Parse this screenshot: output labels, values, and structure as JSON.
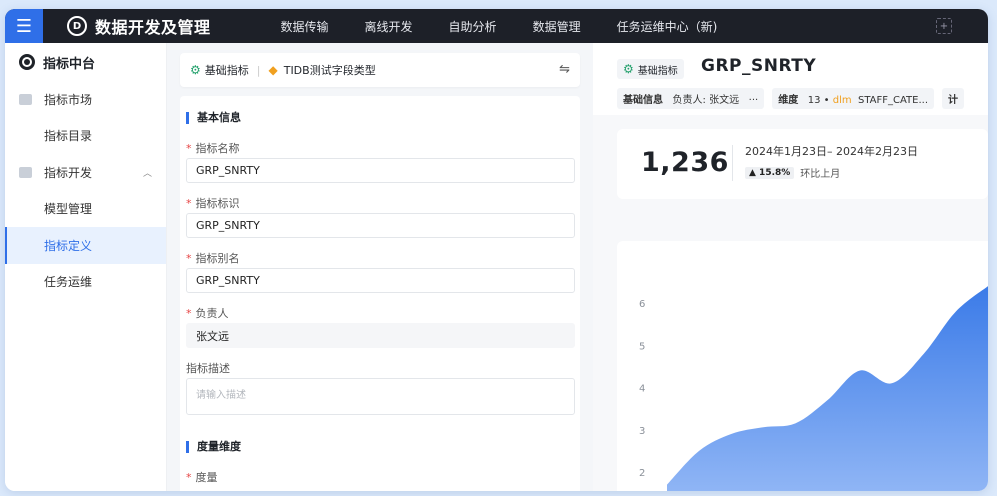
{
  "topbar": {
    "app_title": "数据开发及管理",
    "nav": [
      "数据传输",
      "离线开发",
      "自助分析",
      "数据管理",
      "任务运维中心（新)"
    ]
  },
  "sidebar": {
    "title": "指标中台",
    "items": [
      {
        "label": "指标市场",
        "type": "group"
      },
      {
        "label": "指标目录",
        "type": "child"
      },
      {
        "label": "指标开发",
        "type": "group",
        "expanded": true
      },
      {
        "label": "模型管理",
        "type": "child"
      },
      {
        "label": "指标定义",
        "type": "child",
        "active": true
      },
      {
        "label": "任务运维",
        "type": "child"
      }
    ]
  },
  "breadcrumb": {
    "part1": "基础指标",
    "part2": "TIDB测试字段类型"
  },
  "form": {
    "section1": "基本信息",
    "fields": [
      {
        "label": "指标名称",
        "value": "GRP_SNRTY",
        "required": true
      },
      {
        "label": "指标标识",
        "value": "GRP_SNRTY",
        "required": true
      },
      {
        "label": "指标别名",
        "value": "GRP_SNRTY",
        "required": true
      },
      {
        "label": "负责人",
        "value": "张文远",
        "required": true
      }
    ],
    "desc_label": "指标描述",
    "desc_placeholder": "请输入描述",
    "section2": "度量维度",
    "measure_label": "度量"
  },
  "detail": {
    "tag": "基础指标",
    "name": "GRP_SNRTY",
    "info_label": "基础信息",
    "owner": "负责人: 张文远",
    "more": "···",
    "dim_label": "维度",
    "dim_count": "13",
    "dim_prefix": "dlm",
    "dim_value": "STAFF_CATE...",
    "calc_label": "计",
    "stat_value": "1,236",
    "date_range": "2024年1月23日– 2024年2月23日",
    "trend_value": "▲ 15.8%",
    "trend_label": "环比上月"
  },
  "chart_data": {
    "type": "area",
    "y_ticks": [
      "6",
      "5",
      "4",
      "3",
      "2"
    ],
    "ylim": [
      1.7,
      6.4
    ],
    "x": [
      0,
      1,
      2,
      3,
      4,
      5,
      6,
      7,
      8,
      9,
      10
    ],
    "values": [
      1.7,
      2.5,
      2.9,
      3.06,
      3.15,
      3.7,
      4.4,
      4.1,
      4.8,
      5.8,
      6.4
    ],
    "grid": false,
    "color": "#3b7be8"
  }
}
